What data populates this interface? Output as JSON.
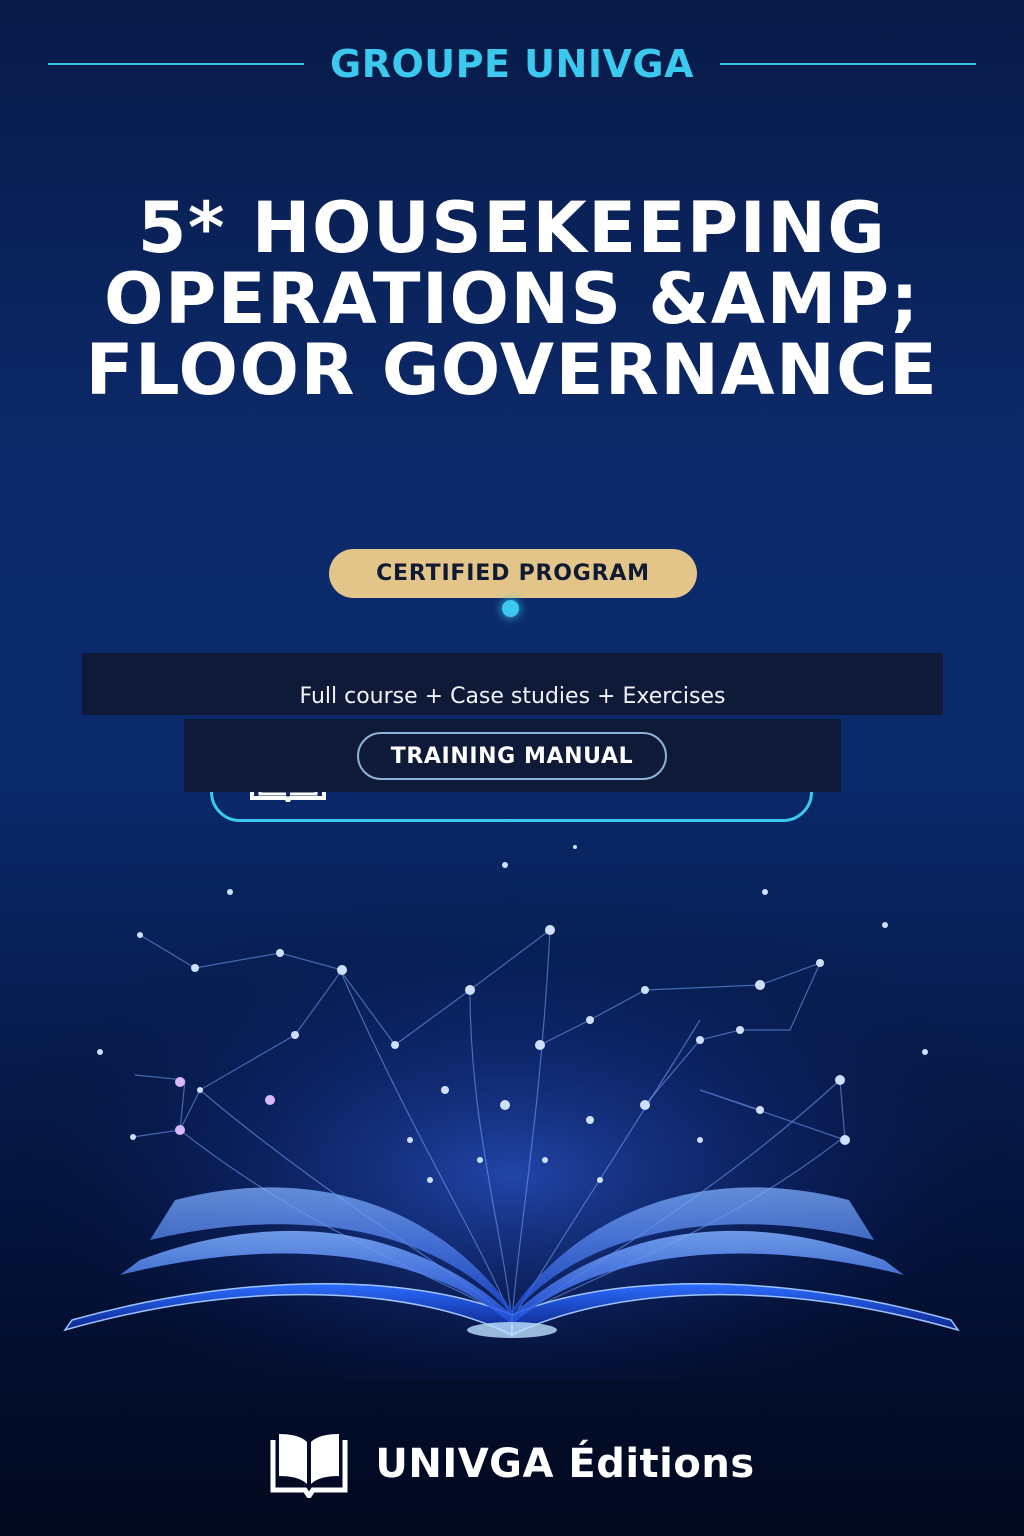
{
  "publisher": {
    "name": "GROUPE UNIVGA"
  },
  "cover": {
    "title": "5* HOUSEKEEPING OPERATIONS &AMP; FLOOR GOVERNANCE",
    "certified_badge": "CERTIFIED PROGRAM",
    "subtitle": "Full course + Case studies + Exercises",
    "manual_badge": "TRAINING MANUAL"
  },
  "footer": {
    "brand": "UNIVGA Éditions",
    "icon": "open-book-icon"
  },
  "colors": {
    "accent": "#3cc9ef",
    "gold": "#e3c58a",
    "navy": "#0f1a38"
  }
}
